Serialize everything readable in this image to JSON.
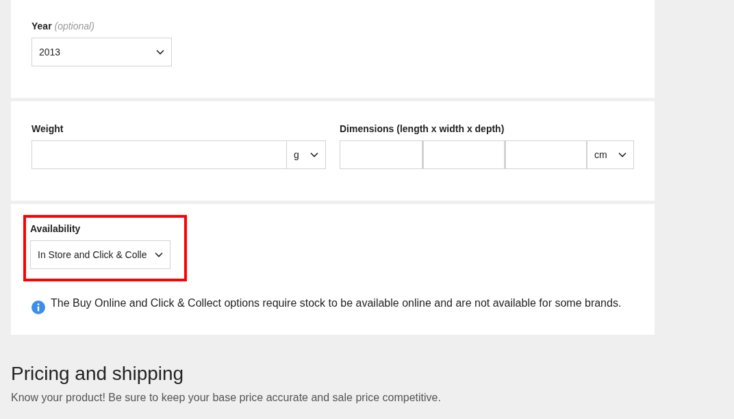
{
  "year": {
    "label": "Year",
    "hint": "(optional)",
    "value": "2013"
  },
  "weight": {
    "label": "Weight",
    "unit": "g"
  },
  "dimensions": {
    "label": "Dimensions (length x width x depth)",
    "unit": "cm"
  },
  "availability": {
    "label": "Availability",
    "value": "In Store and Click & Colle",
    "highlighted": true,
    "note": "The Buy Online and Click & Collect options require stock to be available online and are not available for some brands."
  },
  "section": {
    "title": "Pricing and shipping",
    "subtitle": "Know your product! Be sure to keep your base price accurate and sale price competitive."
  }
}
